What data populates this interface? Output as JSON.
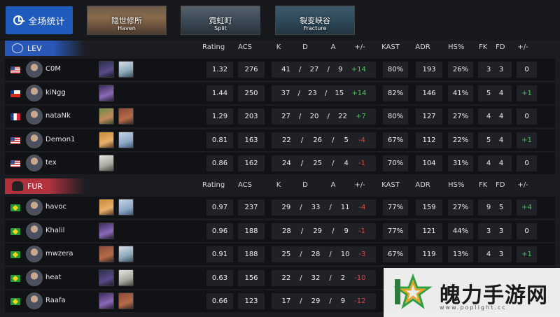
{
  "topbar": {
    "overall_label": "全场统计",
    "maps": [
      {
        "name_cn": "隐世修所",
        "name_en": "Haven"
      },
      {
        "name_cn": "霓虹町",
        "name_en": "Split"
      },
      {
        "name_cn": "裂变峡谷",
        "name_en": "Fracture"
      }
    ]
  },
  "columns": {
    "rating": "Rating",
    "acs": "ACS",
    "k": "K",
    "d": "D",
    "a": "A",
    "pm": "+/-",
    "kast": "KAST",
    "adr": "ADR",
    "hs": "HS%",
    "fk": "FK",
    "fd": "FD",
    "fpm": "+/-"
  },
  "colors": {
    "positive": "#4cc05a",
    "negative": "#e0423e",
    "lev": "#2857b8",
    "fur": "#b0303c",
    "active_button": "#1f5bbd"
  },
  "teams": [
    {
      "name": "LEV",
      "logo_icon": "leviatan-logo-icon",
      "players": [
        {
          "flag": "us",
          "name": "C0M",
          "agents": [
            "omen-agent-icon",
            "sage-agent-icon"
          ],
          "rating": "1.32",
          "acs": "276",
          "k": "41",
          "d": "27",
          "a": "9",
          "pm": "+14",
          "kast": "80%",
          "adr": "193",
          "hs": "26%",
          "fk": "3",
          "fd": "3",
          "fpm": "0"
        },
        {
          "flag": "cl",
          "name": "kiNgg",
          "agents": [
            "reyna-agent-icon"
          ],
          "rating": "1.44",
          "acs": "250",
          "k": "37",
          "d": "23",
          "a": "15",
          "pm": "+14",
          "kast": "82%",
          "adr": "146",
          "hs": "41%",
          "fk": "5",
          "fd": "4",
          "fpm": "+1"
        },
        {
          "flag": "fr",
          "name": "nataNk",
          "agents": [
            "skye-agent-icon",
            "kayo-agent-icon"
          ],
          "rating": "1.29",
          "acs": "203",
          "k": "27",
          "d": "20",
          "a": "22",
          "pm": "+7",
          "kast": "80%",
          "adr": "127",
          "hs": "27%",
          "fk": "4",
          "fd": "4",
          "fpm": "0"
        },
        {
          "flag": "us",
          "name": "Demon1",
          "agents": [
            "phoenix-agent-icon",
            "jett-agent-icon"
          ],
          "rating": "0.81",
          "acs": "163",
          "k": "22",
          "d": "26",
          "a": "5",
          "pm": "-4",
          "kast": "67%",
          "adr": "112",
          "hs": "22%",
          "fk": "5",
          "fd": "4",
          "fpm": "+1"
        },
        {
          "flag": "us",
          "name": "tex",
          "agents": [
            "cypher-agent-icon"
          ],
          "rating": "0.86",
          "acs": "162",
          "k": "24",
          "d": "25",
          "a": "4",
          "pm": "-1",
          "kast": "70%",
          "adr": "104",
          "hs": "31%",
          "fk": "4",
          "fd": "4",
          "fpm": "0"
        }
      ]
    },
    {
      "name": "FUR",
      "logo_icon": "furia-logo-icon",
      "players": [
        {
          "flag": "br",
          "name": "havoc",
          "agents": [
            "phoenix-agent-icon",
            "jett-agent-icon"
          ],
          "rating": "0.97",
          "acs": "237",
          "k": "29",
          "d": "33",
          "a": "11",
          "pm": "-4",
          "kast": "77%",
          "adr": "159",
          "hs": "27%",
          "fk": "9",
          "fd": "5",
          "fpm": "+4"
        },
        {
          "flag": "br",
          "name": "Khalil",
          "agents": [
            "reyna-agent-icon"
          ],
          "rating": "0.96",
          "acs": "188",
          "k": "28",
          "d": "29",
          "a": "9",
          "pm": "-1",
          "kast": "77%",
          "adr": "121",
          "hs": "44%",
          "fk": "3",
          "fd": "3",
          "fpm": "0"
        },
        {
          "flag": "br",
          "name": "mwzera",
          "agents": [
            "kayo-agent-icon",
            "sage-agent-icon"
          ],
          "rating": "0.91",
          "acs": "188",
          "k": "25",
          "d": "28",
          "a": "10",
          "pm": "-3",
          "kast": "67%",
          "adr": "119",
          "hs": "13%",
          "fk": "4",
          "fd": "3",
          "fpm": "+1"
        },
        {
          "flag": "br",
          "name": "heat",
          "agents": [
            "omen-agent-icon",
            "cypher-agent-icon"
          ],
          "rating": "0.63",
          "acs": "156",
          "k": "22",
          "d": "32",
          "a": "2",
          "pm": "-10",
          "kast": "",
          "adr": "",
          "hs": "",
          "fk": "",
          "fd": "",
          "fpm": ""
        },
        {
          "flag": "br",
          "name": "Raafa",
          "agents": [
            "reyna-agent-icon",
            "kayo-agent-icon"
          ],
          "rating": "0.66",
          "acs": "123",
          "k": "17",
          "d": "29",
          "a": "9",
          "pm": "-12",
          "kast": "",
          "adr": "",
          "hs": "",
          "fk": "",
          "fd": "",
          "fpm": ""
        }
      ]
    }
  ],
  "watermark": {
    "text": "魄力手游网",
    "url": "www.poplight.cc"
  }
}
